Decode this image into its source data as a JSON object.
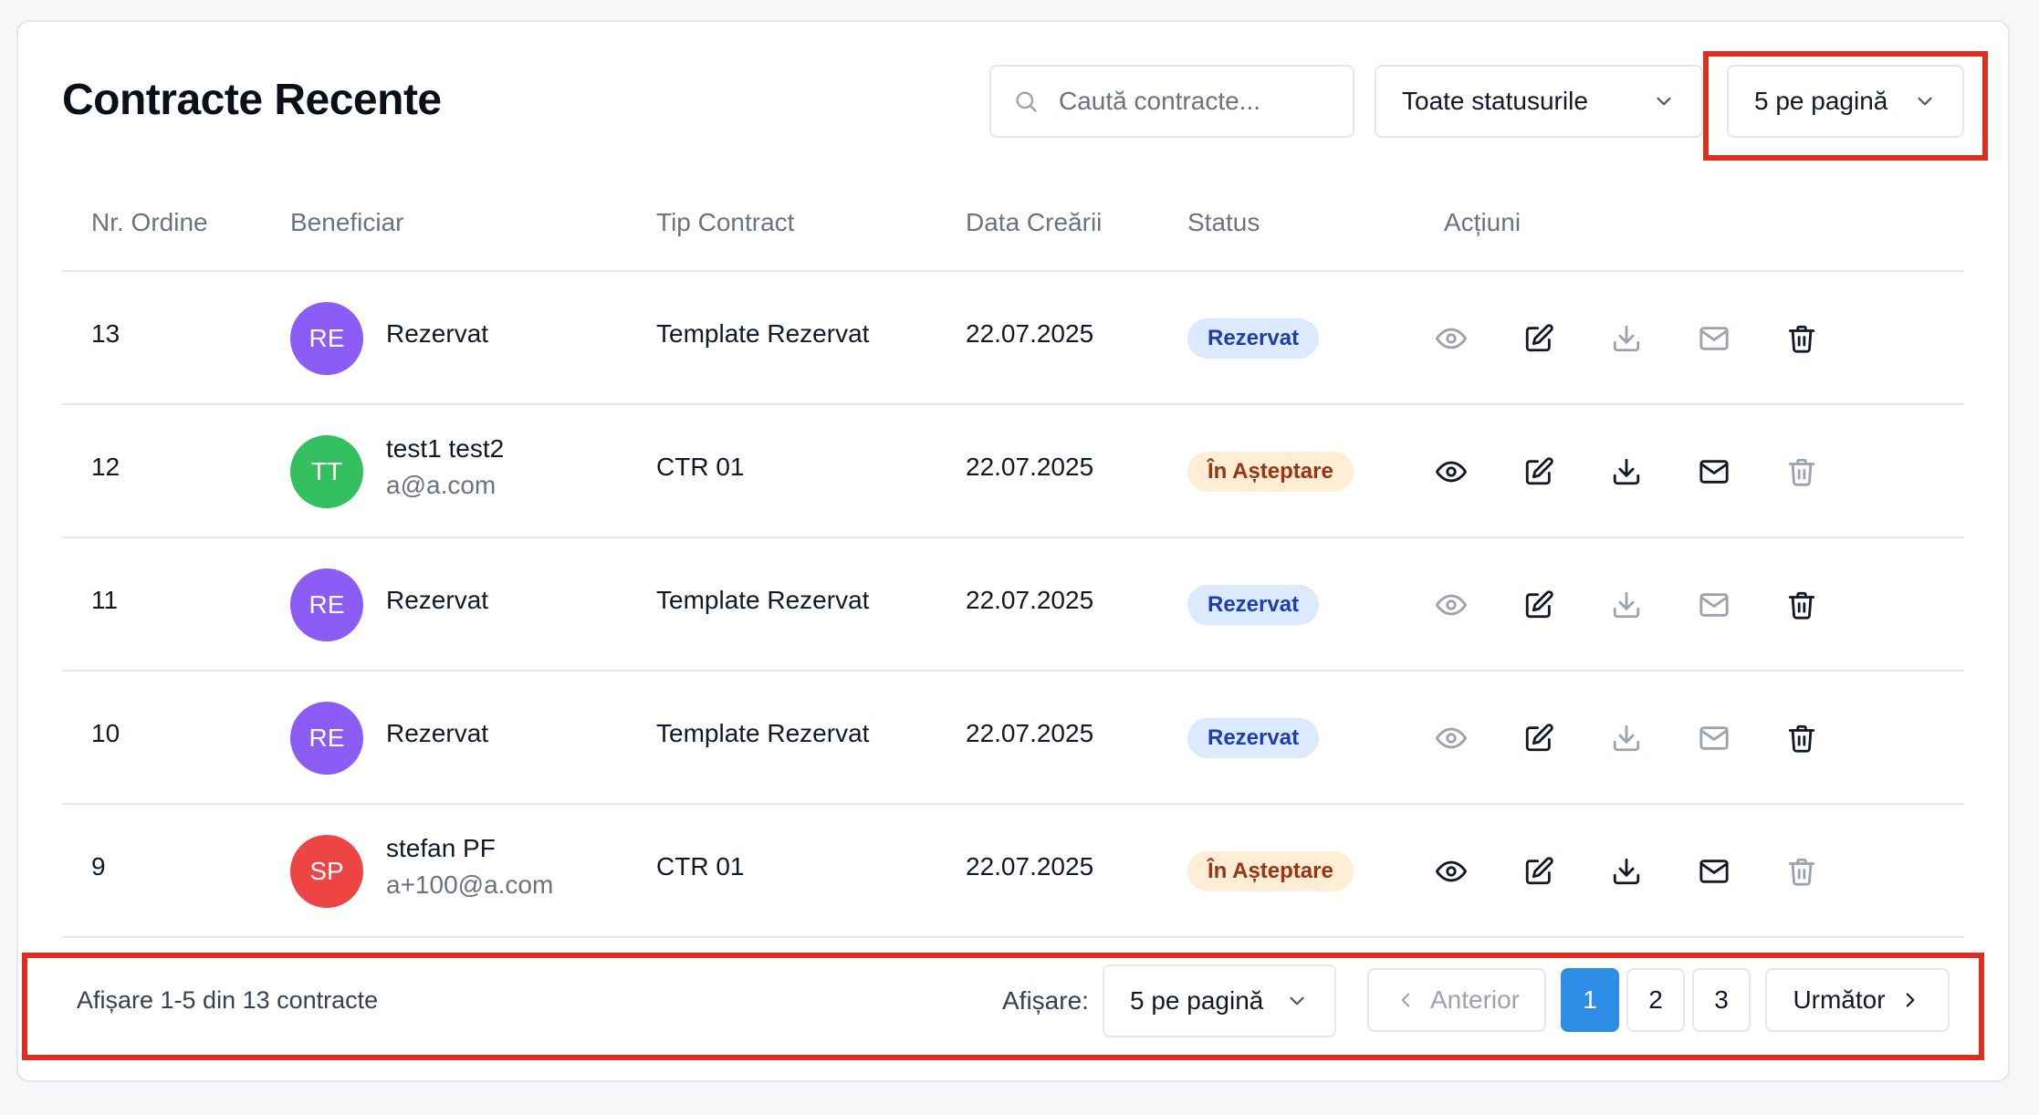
{
  "header": {
    "title": "Contracte Recente",
    "search_placeholder": "Caută contracte...",
    "status_filter": "Toate statusurile",
    "per_page": "5 pe pagină"
  },
  "columns": [
    "Nr. Ordine",
    "Beneficiar",
    "Tip Contract",
    "Data Creării",
    "Status",
    "Acțiuni"
  ],
  "rows": [
    {
      "nr": "13",
      "initials": "RE",
      "avatar_color": "#8b5cf6",
      "name": "Rezervat",
      "email": "",
      "type": "Template Rezervat",
      "date": "22.07.2025",
      "status": "Rezervat",
      "status_kind": "reserved"
    },
    {
      "nr": "12",
      "initials": "TT",
      "avatar_color": "#34c061",
      "name": "test1 test2",
      "email": "a@a.com",
      "type": "CTR 01",
      "date": "22.07.2025",
      "status": "În Așteptare",
      "status_kind": "pending"
    },
    {
      "nr": "11",
      "initials": "RE",
      "avatar_color": "#8b5cf6",
      "name": "Rezervat",
      "email": "",
      "type": "Template Rezervat",
      "date": "22.07.2025",
      "status": "Rezervat",
      "status_kind": "reserved"
    },
    {
      "nr": "10",
      "initials": "RE",
      "avatar_color": "#8b5cf6",
      "name": "Rezervat",
      "email": "",
      "type": "Template Rezervat",
      "date": "22.07.2025",
      "status": "Rezervat",
      "status_kind": "reserved"
    },
    {
      "nr": "9",
      "initials": "SP",
      "avatar_color": "#ef4444",
      "name": "stefan PF",
      "email": "a+100@a.com",
      "type": "CTR 01",
      "date": "22.07.2025",
      "status": "În Așteptare",
      "status_kind": "pending"
    }
  ],
  "actions": [
    "eye-icon",
    "edit-icon",
    "download-icon",
    "mail-icon",
    "trash-icon"
  ],
  "footer": {
    "info": "Afișare 1-5 din 13 contracte",
    "show_label": "Afișare:",
    "per_page": "5 pe pagină",
    "prev": "Anterior",
    "pages": [
      "1",
      "2",
      "3"
    ],
    "current_page": "1",
    "next": "Următor"
  },
  "colors": {
    "reserved_bg": "#dbeafe",
    "reserved_fg": "#1e40af",
    "pending_bg": "#ffedd5",
    "pending_fg": "#9a3412",
    "highlight": "#dc2f1f",
    "primary": "#2d8ee8"
  }
}
